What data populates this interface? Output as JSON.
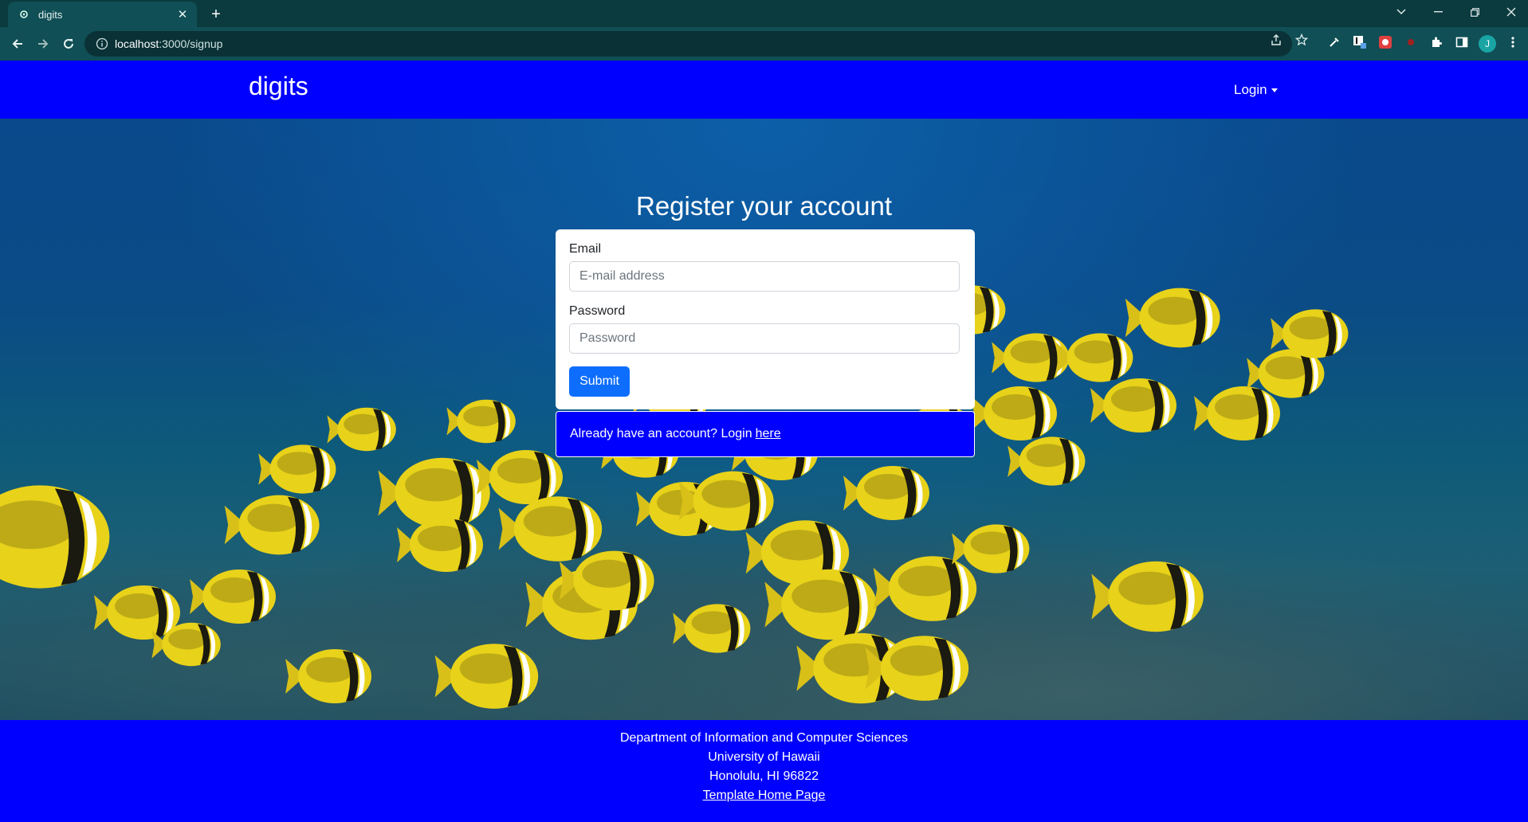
{
  "browser": {
    "tab_title": "digits",
    "new_tab_symbol": "+",
    "url_host": "localhost",
    "url_path": ":3000/signup",
    "profile_initial": "J"
  },
  "navbar": {
    "brand": "digits",
    "login_label": "Login"
  },
  "form": {
    "heading": "Register your account",
    "email_label": "Email",
    "email_placeholder": "E-mail address",
    "email_value": "",
    "password_label": "Password",
    "password_placeholder": "Password",
    "password_value": "",
    "submit_label": "Submit"
  },
  "message": {
    "text": "Already have an account? Login",
    "link_text": "here"
  },
  "footer": {
    "line1": "Department of Information and Computer Sciences",
    "line2": "University of Hawaii",
    "line3": "Honolulu, HI 96822",
    "link": "Template Home Page"
  },
  "colors": {
    "navbar_bg": "#0000ff",
    "button_primary": "#0d6efd",
    "chrome_bg": "#0f4f55"
  }
}
